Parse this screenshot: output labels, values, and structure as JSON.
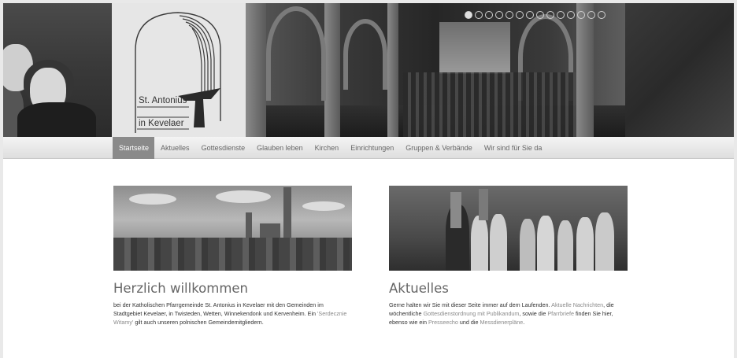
{
  "header": {
    "logo_line1": "St. Antonius",
    "logo_line2": "in Kevelaer",
    "slider_dots": 14,
    "active_dot": 0
  },
  "nav": {
    "items": [
      "Startseite",
      "Aktuelles",
      "Gottesdienste",
      "Glauben leben",
      "Kirchen",
      "Einrichtungen",
      "Gruppen & Verbände",
      "Wir sind für Sie da"
    ],
    "active_index": 0
  },
  "content": {
    "welcome": {
      "title": "Herzlich willkommen",
      "text_1": "bei der Katholischen Pfarrgemeinde St. Antonius in Kevelaer mit den Gemeinden im Stadtgebiet Kevelaer, in Twisteden, Wetten, Winnekendonk und Kervenheim. Ein ",
      "link_1": "'Serdecznie Witamy'",
      "text_2": " gilt auch unseren polnischen Gemeindemitgliedern."
    },
    "news": {
      "title": "Aktuelles",
      "text_1": "Gerne halten wir Sie mit dieser Seite immer auf dem Laufenden. ",
      "link_1": "Aktuelle Nachrichten",
      "text_2": ", die wöchentliche ",
      "link_2": "Gottesdienstordnung mit Publikandum",
      "text_3": ", sowie die ",
      "link_3": "Pfarrbriefe",
      "text_4": " finden Sie hier, ebenso wie ein ",
      "link_4": "Presseecho",
      "text_5": " und die ",
      "link_5": "Messdienerpläne",
      "text_6": "."
    }
  },
  "icons": {
    "slider_dot": "circle-outline",
    "logo": "st-antonius-tau-cross-logo"
  },
  "colors": {
    "nav_active_bg": "#8a8a8a",
    "nav_text": "#666666",
    "link": "#8a8a8a",
    "title": "#666666"
  }
}
